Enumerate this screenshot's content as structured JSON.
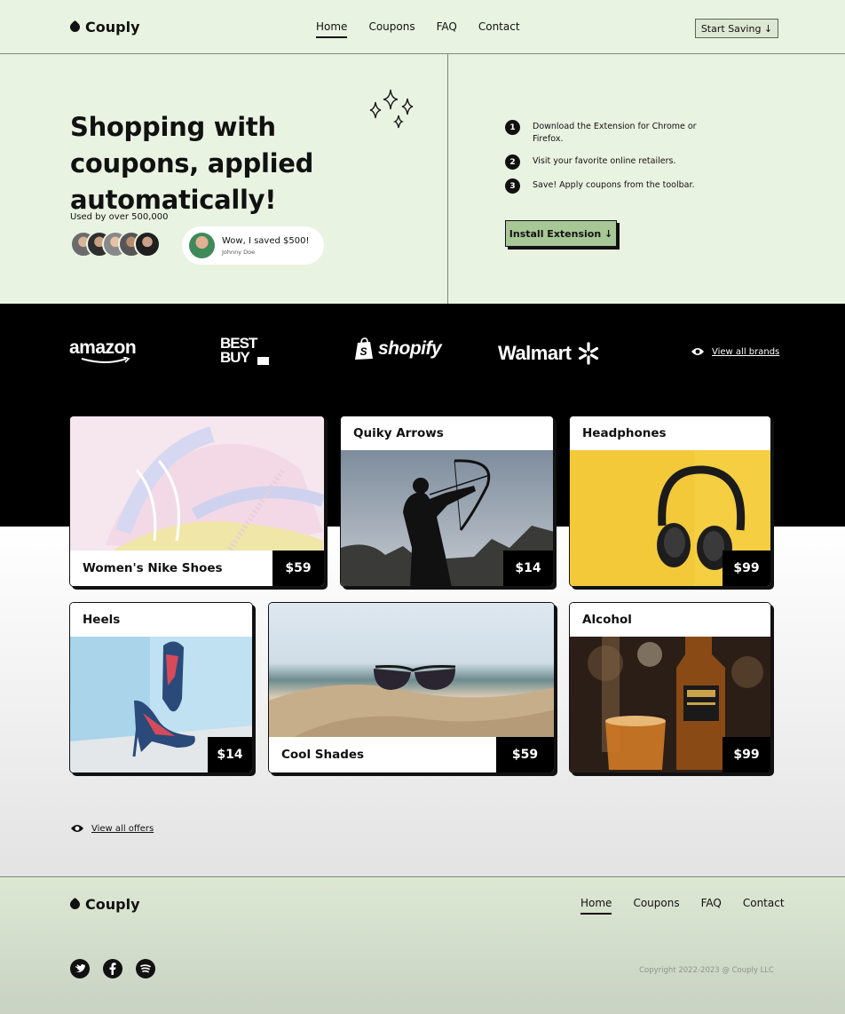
{
  "brand": {
    "name": "Couply"
  },
  "nav": {
    "items": [
      {
        "label": "Home",
        "active": true
      },
      {
        "label": "Coupons",
        "active": false
      },
      {
        "label": "FAQ",
        "active": false
      },
      {
        "label": "Contact",
        "active": false
      }
    ],
    "cta": "Start Saving ↓"
  },
  "hero": {
    "title": "Shopping with coupons, applied automatically!",
    "used_by": "Used by over 500,000",
    "testimonial": {
      "quote": "Wow, I saved $500!",
      "name": "Johnny Doe"
    },
    "steps": [
      {
        "num": "1",
        "text": "Download the Extension for Chrome or Firefox."
      },
      {
        "num": "2",
        "text": "Visit your favorite online retailers."
      },
      {
        "num": "3",
        "text": "Save! Apply coupons from the toolbar."
      }
    ],
    "install": "Install Extension ↓"
  },
  "brands": {
    "logos": [
      "amazon",
      "BEST BUY",
      "shopify",
      "Walmart"
    ],
    "view_all": "View all brands"
  },
  "offers": [
    {
      "title": "Women's Nike Shoes",
      "price": "$59"
    },
    {
      "title": "Quiky Arrows",
      "price": "$14"
    },
    {
      "title": "Headphones",
      "price": "$99"
    },
    {
      "title": "Heels",
      "price": "$14"
    },
    {
      "title": "Cool Shades",
      "price": "$59"
    },
    {
      "title": "Alcohol",
      "price": "$99"
    }
  ],
  "view_all_offers": "View all offers",
  "footer": {
    "brand": "Couply",
    "nav": [
      "Home",
      "Coupons",
      "FAQ",
      "Contact"
    ],
    "socials": [
      "twitter-icon",
      "facebook-icon",
      "spotify-icon"
    ],
    "copyright": "Copyright 2022-2023 @ Couply LLC"
  },
  "colors": {
    "mint": "#e9f3e2",
    "accent": "#a8c796",
    "black": "#000000"
  }
}
